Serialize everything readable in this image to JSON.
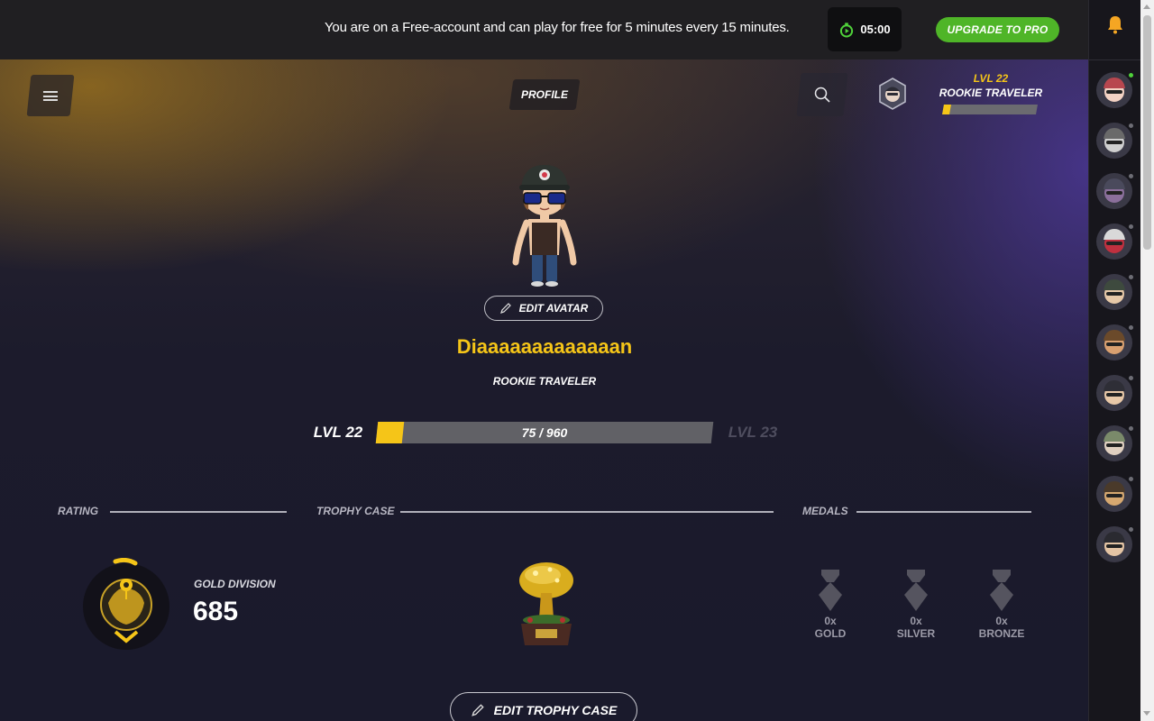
{
  "banner": {
    "message": "You are on a Free-account and can play for free for 5 minutes every 15 minutes.",
    "timer": "05:00",
    "upgrade_label": "UPGRADE TO PRO",
    "upgrade_color": "#4fb528"
  },
  "header": {
    "active_tab": "PROFILE",
    "level_label": "LVL 22",
    "title": "ROOKIE TRAVELER",
    "xp_fraction": 0.078
  },
  "profile": {
    "edit_avatar_label": "EDIT AVATAR",
    "username": "Diaaaaaaaaaaaaan",
    "title": "ROOKIE TRAVELER",
    "level_current": "LVL 22",
    "level_next": "LVL 23",
    "xp_text": "75 / 960",
    "xp_current": 75,
    "xp_total": 960,
    "accent_color": "#f5c518"
  },
  "sections": {
    "rating": "RATING",
    "trophy_case": "TROPHY CASE",
    "medals": "MEDALS"
  },
  "rating": {
    "division": "GOLD DIVISION",
    "value": "685"
  },
  "medals": [
    {
      "count": "0x",
      "name": "GOLD"
    },
    {
      "count": "0x",
      "name": "SILVER"
    },
    {
      "count": "0x",
      "name": "BRONZE"
    }
  ],
  "edit_trophy_label": "EDIT TROPHY CASE",
  "sidebar": {
    "icons": [
      "bell-icon"
    ],
    "friends": [
      {
        "online": true
      },
      {
        "online": false
      },
      {
        "online": false
      },
      {
        "online": false
      },
      {
        "online": false
      },
      {
        "online": false
      },
      {
        "online": false
      },
      {
        "online": false
      },
      {
        "online": false
      },
      {
        "online": false
      }
    ]
  }
}
